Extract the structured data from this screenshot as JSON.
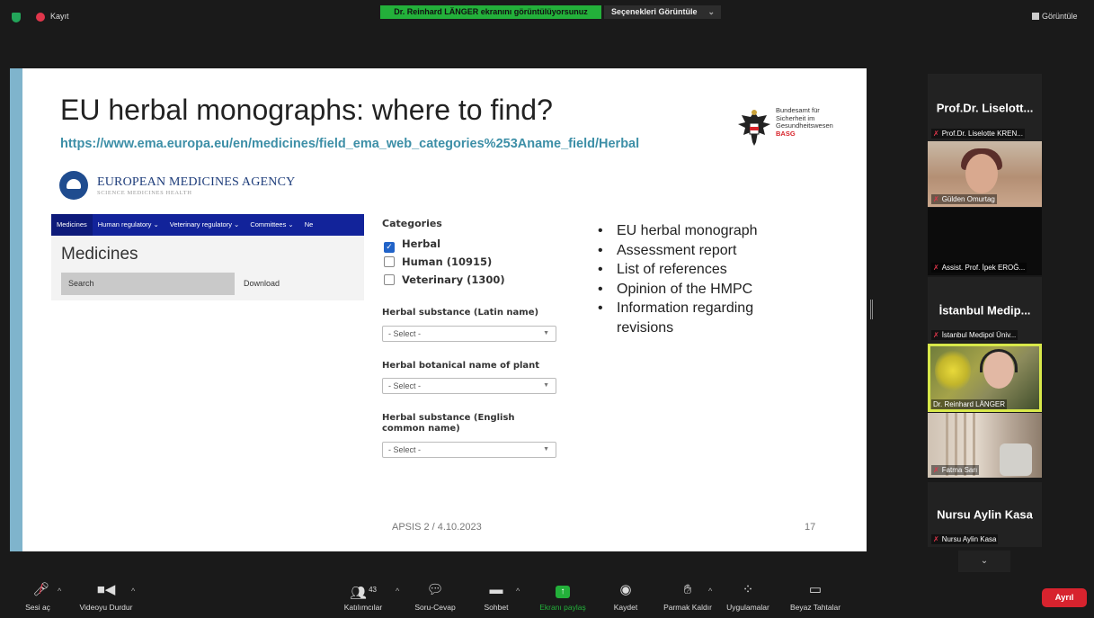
{
  "topbar": {
    "recording_label": "Kayıt",
    "share_banner": "Dr. Reinhard LÄNGER ekranını görüntülüyorsunuz",
    "view_options": "Seçenekleri Görüntüle",
    "view_button": "Görüntüle"
  },
  "slide": {
    "title": "EU herbal monographs: where to find?",
    "url": "https://www.ema.europa.eu/en/medicines/field_ema_web_categories%253Aname_field/Herbal",
    "basg": {
      "line1": "Bundesamt für",
      "line2": "Sicherheit im",
      "line3": "Gesundheitswesen",
      "abbr": "BASG"
    },
    "ema": {
      "name": "EUROPEAN MEDICINES AGENCY",
      "tagline": "SCIENCE   MEDICINES   HEALTH",
      "nav": [
        "Medicines",
        "Human regulatory ⌄",
        "Veterinary regulatory ⌄",
        "Committees ⌄",
        "Ne"
      ],
      "page_title": "Medicines",
      "search_label": "Search",
      "download_label": "Download"
    },
    "categories": {
      "title": "Categories",
      "items": [
        {
          "label": "Herbal",
          "checked": true
        },
        {
          "label": "Human (10915)",
          "checked": false
        },
        {
          "label": "Veterinary (1300)",
          "checked": false
        }
      ]
    },
    "filters": [
      {
        "label": "Herbal substance (Latin name)",
        "value": "- Select -"
      },
      {
        "label": "Herbal botanical name of plant",
        "value": "- Select -"
      },
      {
        "label": "Herbal substance (English common name)",
        "value": "- Select -"
      }
    ],
    "bullets": [
      "EU herbal monograph",
      "Assessment report",
      "List of references",
      "Opinion of the HMPC",
      "Information regarding revisions"
    ],
    "footer": "APSIS 2 / 4.10.2023",
    "page_number": "17"
  },
  "participants": [
    {
      "type": "name",
      "big": "Prof.Dr.  Liselott...",
      "label": "Prof.Dr. Liselotte KREN..."
    },
    {
      "type": "video",
      "label": "Gülden Omurtag"
    },
    {
      "type": "dark",
      "label": "Assist. Prof. İpek EROĞ..."
    },
    {
      "type": "name",
      "big": "İstanbul  Medip...",
      "label": "İstanbul Medipol Üniv..."
    },
    {
      "type": "video",
      "label": "Dr. Reinhard LÄNGER"
    },
    {
      "type": "video",
      "label": "Fatma Sarı"
    },
    {
      "type": "name",
      "big": "Nursu Aylin Kasa",
      "label": "Nursu Aylin Kasa"
    }
  ],
  "toolbar": {
    "mute": "Sesi aç",
    "video": "Videoyu Durdur",
    "participants": "Katılımcılar",
    "participants_count": "43",
    "qa": "Soru-Cevap",
    "chat": "Sohbet",
    "share": "Ekranı paylaş",
    "record": "Kaydet",
    "raise_hand": "Parmak Kaldır",
    "apps": "Uygulamalar",
    "whiteboard": "Beyaz Tahtalar",
    "end": "Ayrıl"
  },
  "colors": {
    "share_green": "#23b03a",
    "end_red": "#d7232e",
    "slide_url": "#3d8fa7",
    "ema_nav": "#12239a",
    "active_speaker": "#d8e84a"
  }
}
